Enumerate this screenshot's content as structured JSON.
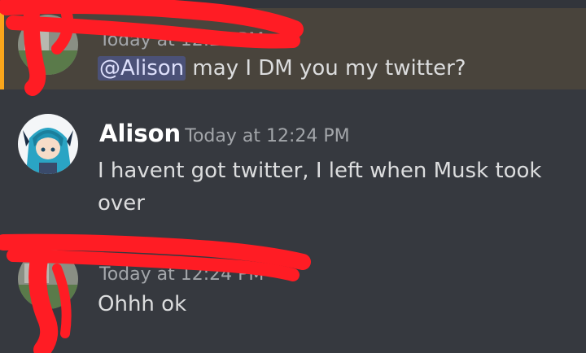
{
  "messages": [
    {
      "username": "",
      "timestamp": "Today at 12:23 PM",
      "mention": "@Alison",
      "text": " may I DM you my twitter?"
    },
    {
      "username": "Alison",
      "timestamp": "Today at 12:24 PM",
      "text_line1": "I havent got twitter, I left when Musk took",
      "text_line2": "over"
    },
    {
      "username": "",
      "timestamp": "Today at 12:24 PM",
      "text": "Ohhh ok"
    }
  ],
  "colors": {
    "background": "#36393f",
    "mention_highlight": "#49443c",
    "mention_bar": "#faa61a",
    "ping_bg": "#4b5177",
    "ping_text": "#dee0fc",
    "redaction": "#ff1c24"
  }
}
